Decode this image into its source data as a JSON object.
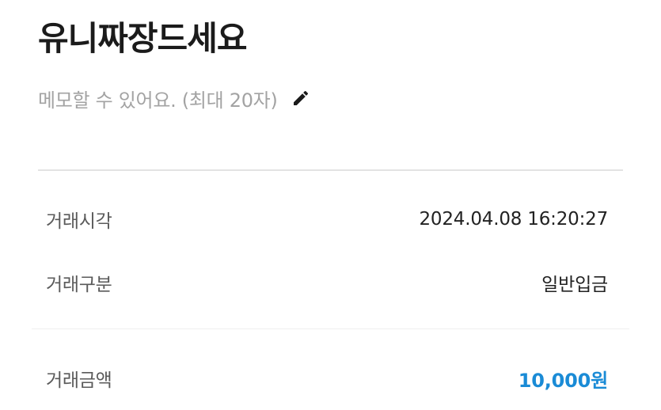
{
  "header": {
    "title": "유니짜장드세요"
  },
  "memo": {
    "placeholder": "메모할 수 있어요. (최대 20자)",
    "edit_icon": "pencil-icon"
  },
  "details": {
    "time_label": "거래시각",
    "time_value": "2024.04.08 16:20:27",
    "type_label": "거래구분",
    "type_value": "일반입금",
    "amount_label": "거래금액",
    "amount_value": "10,000원"
  },
  "colors": {
    "amount": "#1a8bd6",
    "memo_text": "#a3a3a3",
    "divider": "#e3e3e3"
  }
}
